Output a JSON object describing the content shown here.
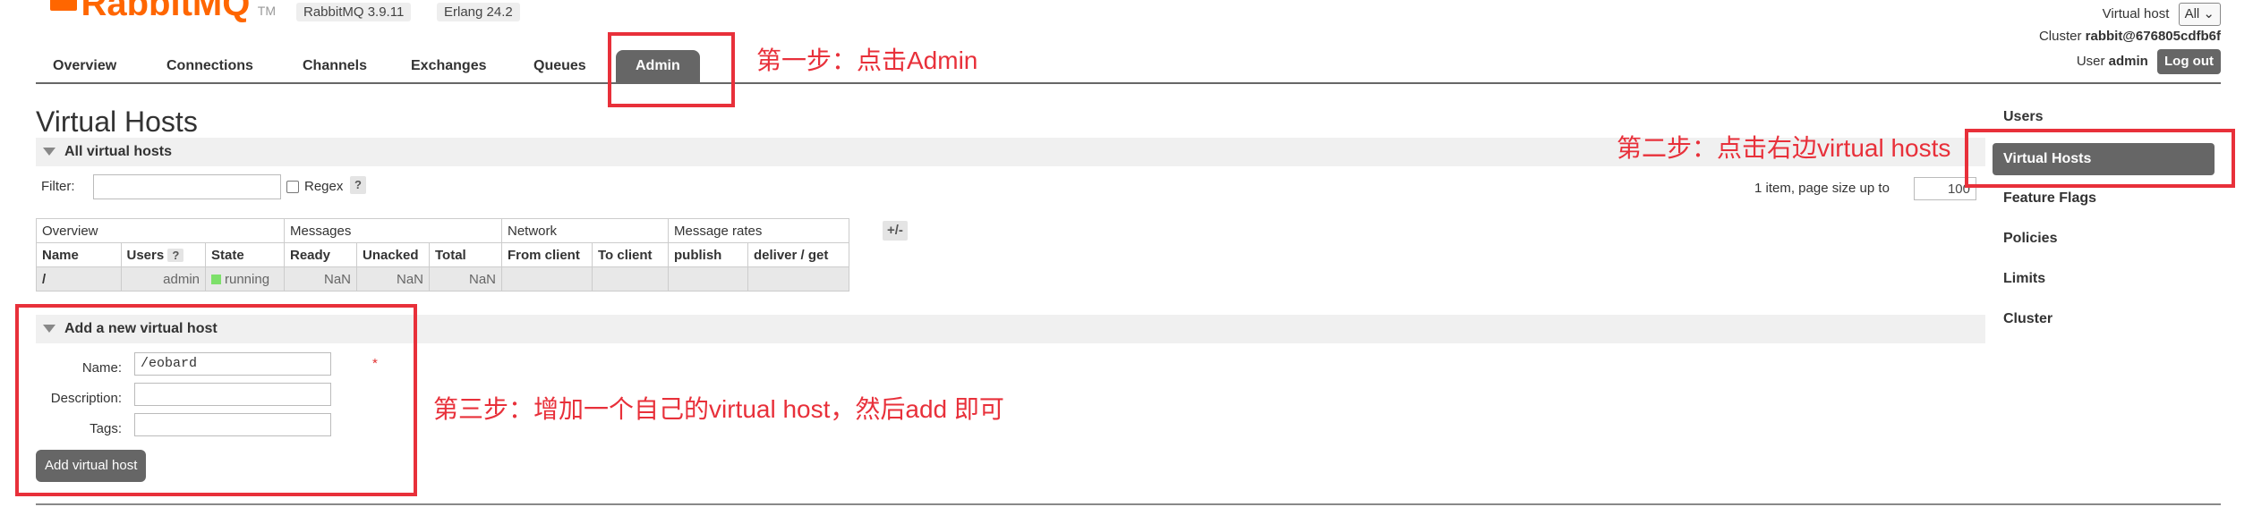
{
  "header": {
    "logo_text": "RabbitMQ",
    "logo_tm": "TM",
    "version": "RabbitMQ 3.9.11",
    "erlang": "Erlang 24.2",
    "vhost_label": "Virtual host",
    "vhost_selected": "All",
    "cluster_label": "Cluster",
    "cluster_value": "rabbit@676805cdfb6f",
    "user_label": "User",
    "user_value": "admin",
    "logout": "Log out"
  },
  "nav": {
    "tabs": [
      "Overview",
      "Connections",
      "Channels",
      "Exchanges",
      "Queues",
      "Admin"
    ],
    "active": "Admin"
  },
  "page": {
    "title": "Virtual Hosts",
    "all_section": "All virtual hosts",
    "filter_label": "Filter:",
    "regex_label": "Regex",
    "help": "?",
    "paging_text": "1 item, page size up to",
    "page_size": "100",
    "plusminus": "+/-"
  },
  "table": {
    "groups": [
      "Overview",
      "Messages",
      "Network",
      "Message rates"
    ],
    "columns": [
      "Name",
      "Users",
      "State",
      "Ready",
      "Unacked",
      "Total",
      "From client",
      "To client",
      "publish",
      "deliver / get"
    ],
    "rows": [
      {
        "name": "/",
        "users": "admin",
        "state": "running",
        "ready": "NaN",
        "unacked": "NaN",
        "total": "NaN"
      }
    ]
  },
  "add_form": {
    "section": "Add a new virtual host",
    "name_label": "Name:",
    "name_value": "/eobard",
    "required": "*",
    "desc_label": "Description:",
    "tags_label": "Tags:",
    "button": "Add virtual host"
  },
  "sidebar": {
    "items": [
      "Users",
      "Virtual Hosts",
      "Feature Flags",
      "Policies",
      "Limits",
      "Cluster"
    ],
    "active": "Virtual Hosts"
  },
  "annotations": {
    "step1": "第一步：点击Admin",
    "step2": "第二步：点击右边virtual hosts",
    "step3": "第三步：增加一个自己的virtual host，然后add 即可"
  },
  "colors": {
    "brand": "#ff6600",
    "annotation_red": "#e8303a",
    "active_tab": "#666666",
    "running_green": "#7de06a"
  }
}
